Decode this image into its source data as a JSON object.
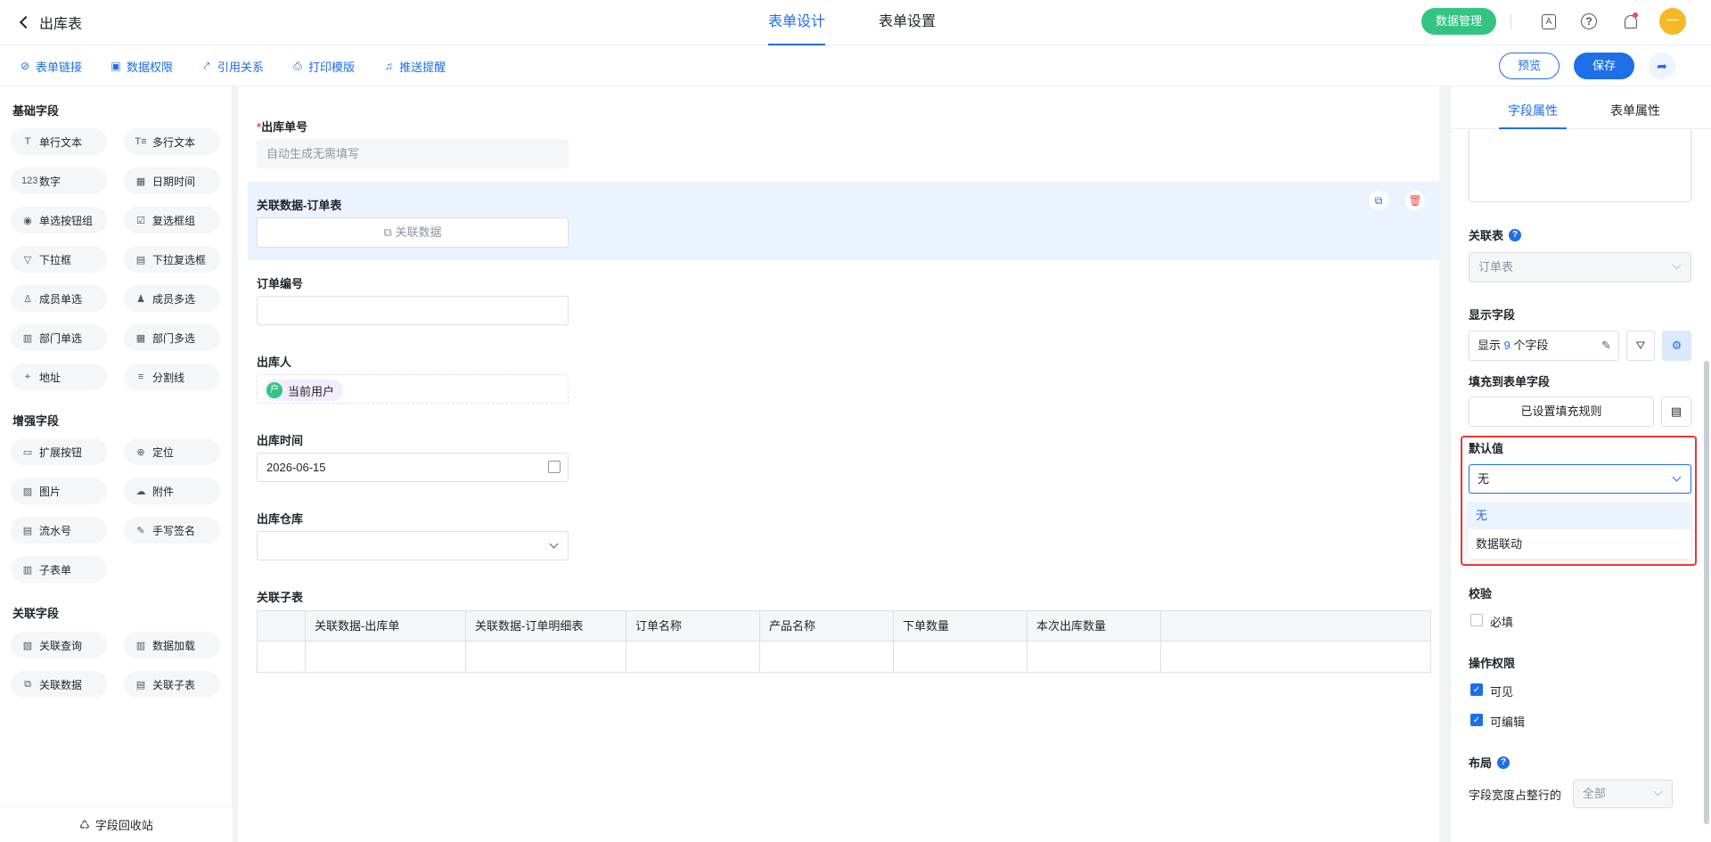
{
  "header": {
    "title": "出库表",
    "tabs": [
      {
        "label": "表单设计"
      },
      {
        "label": "表单设置"
      }
    ],
    "data_mgmt_label": "数据管理",
    "avatar_text": "一"
  },
  "toolbar": {
    "items": [
      {
        "label": "表单链接",
        "icon": "link-icon"
      },
      {
        "label": "数据权限",
        "icon": "data-permission-icon"
      },
      {
        "label": "引用关系",
        "icon": "reference-icon"
      },
      {
        "label": "打印模版",
        "icon": "print-icon"
      },
      {
        "label": "推送提醒",
        "icon": "bell-icon"
      }
    ],
    "preview_label": "预览",
    "save_label": "保存"
  },
  "left_panel": {
    "basic_title": "基础字段",
    "basic_fields": [
      {
        "label": "单行文本",
        "glyph": "T"
      },
      {
        "label": "多行文本",
        "glyph": "T≡"
      },
      {
        "label": "数字",
        "glyph": "123"
      },
      {
        "label": "日期时间",
        "glyph": "▦"
      },
      {
        "label": "单选按钮组",
        "glyph": "◉"
      },
      {
        "label": "复选框组",
        "glyph": "☑"
      },
      {
        "label": "下拉框",
        "glyph": "▽"
      },
      {
        "label": "下拉复选框",
        "glyph": "▤"
      },
      {
        "label": "成员单选",
        "glyph": "♙"
      },
      {
        "label": "成员多选",
        "glyph": "♟"
      },
      {
        "label": "部门单选",
        "glyph": "▥"
      },
      {
        "label": "部门多选",
        "glyph": "▦"
      },
      {
        "label": "地址",
        "glyph": "⌖"
      },
      {
        "label": "分割线",
        "glyph": "≡"
      }
    ],
    "advanced_title": "增强字段",
    "advanced_fields": [
      {
        "label": "扩展按钮",
        "glyph": "▭"
      },
      {
        "label": "定位",
        "glyph": "⊕"
      },
      {
        "label": "图片",
        "glyph": "▨"
      },
      {
        "label": "附件",
        "glyph": "☁"
      },
      {
        "label": "流水号",
        "glyph": "▤"
      },
      {
        "label": "手写签名",
        "glyph": "✎"
      },
      {
        "label": "子表单",
        "glyph": "▥"
      }
    ],
    "relation_title": "关联字段",
    "relation_fields": [
      {
        "label": "关联查询",
        "glyph": "▧"
      },
      {
        "label": "数据加载",
        "glyph": "▥"
      },
      {
        "label": "关联数据",
        "glyph": "⧉"
      },
      {
        "label": "关联子表",
        "glyph": "▤"
      }
    ],
    "recycle_label": "字段回收站"
  },
  "form": {
    "out_no_label": "出库单号",
    "out_no_placeholder": "自动生成无需填写",
    "assoc_label": "关联数据-订单表",
    "assoc_button": "关联数据",
    "order_no_label": "订单编号",
    "operator_label": "出库人",
    "operator_value": "当前用户",
    "operator_avatar": "户",
    "time_label": "出库时间",
    "time_value": "2026-06-15",
    "warehouse_label": "出库仓库",
    "subtable_label": "关联子表",
    "subtable_columns": [
      "关联数据-出库单",
      "关联数据-订单明细表",
      "订单名称",
      "产品名称",
      "下单数量",
      "本次出库数量"
    ]
  },
  "right_panel": {
    "tabs": [
      {
        "label": "字段属性"
      },
      {
        "label": "表单属性"
      }
    ],
    "related_table_label": "关联表",
    "related_table_value": "订单表",
    "display_fields_label": "显示字段",
    "display_prefix": "显示",
    "display_count": "9",
    "display_suffix": "个字段",
    "fill_label": "填充到表单字段",
    "fill_button": "已设置填充规则",
    "default_label": "默认值",
    "default_value": "无",
    "default_options": [
      "无",
      "数据联动"
    ],
    "validation_label": "校验",
    "required_label": "必填",
    "required_checked": false,
    "permission_label": "操作权限",
    "visible_label": "可见",
    "visible_checked": true,
    "editable_label": "可编辑",
    "editable_checked": true,
    "layout_label": "布局",
    "width_label": "字段宽度占整行的",
    "width_value": "全部"
  },
  "colors": {
    "accent": "#1e6ee8",
    "green": "#33c482",
    "danger": "#f54a45",
    "highlight": "#e53935"
  }
}
